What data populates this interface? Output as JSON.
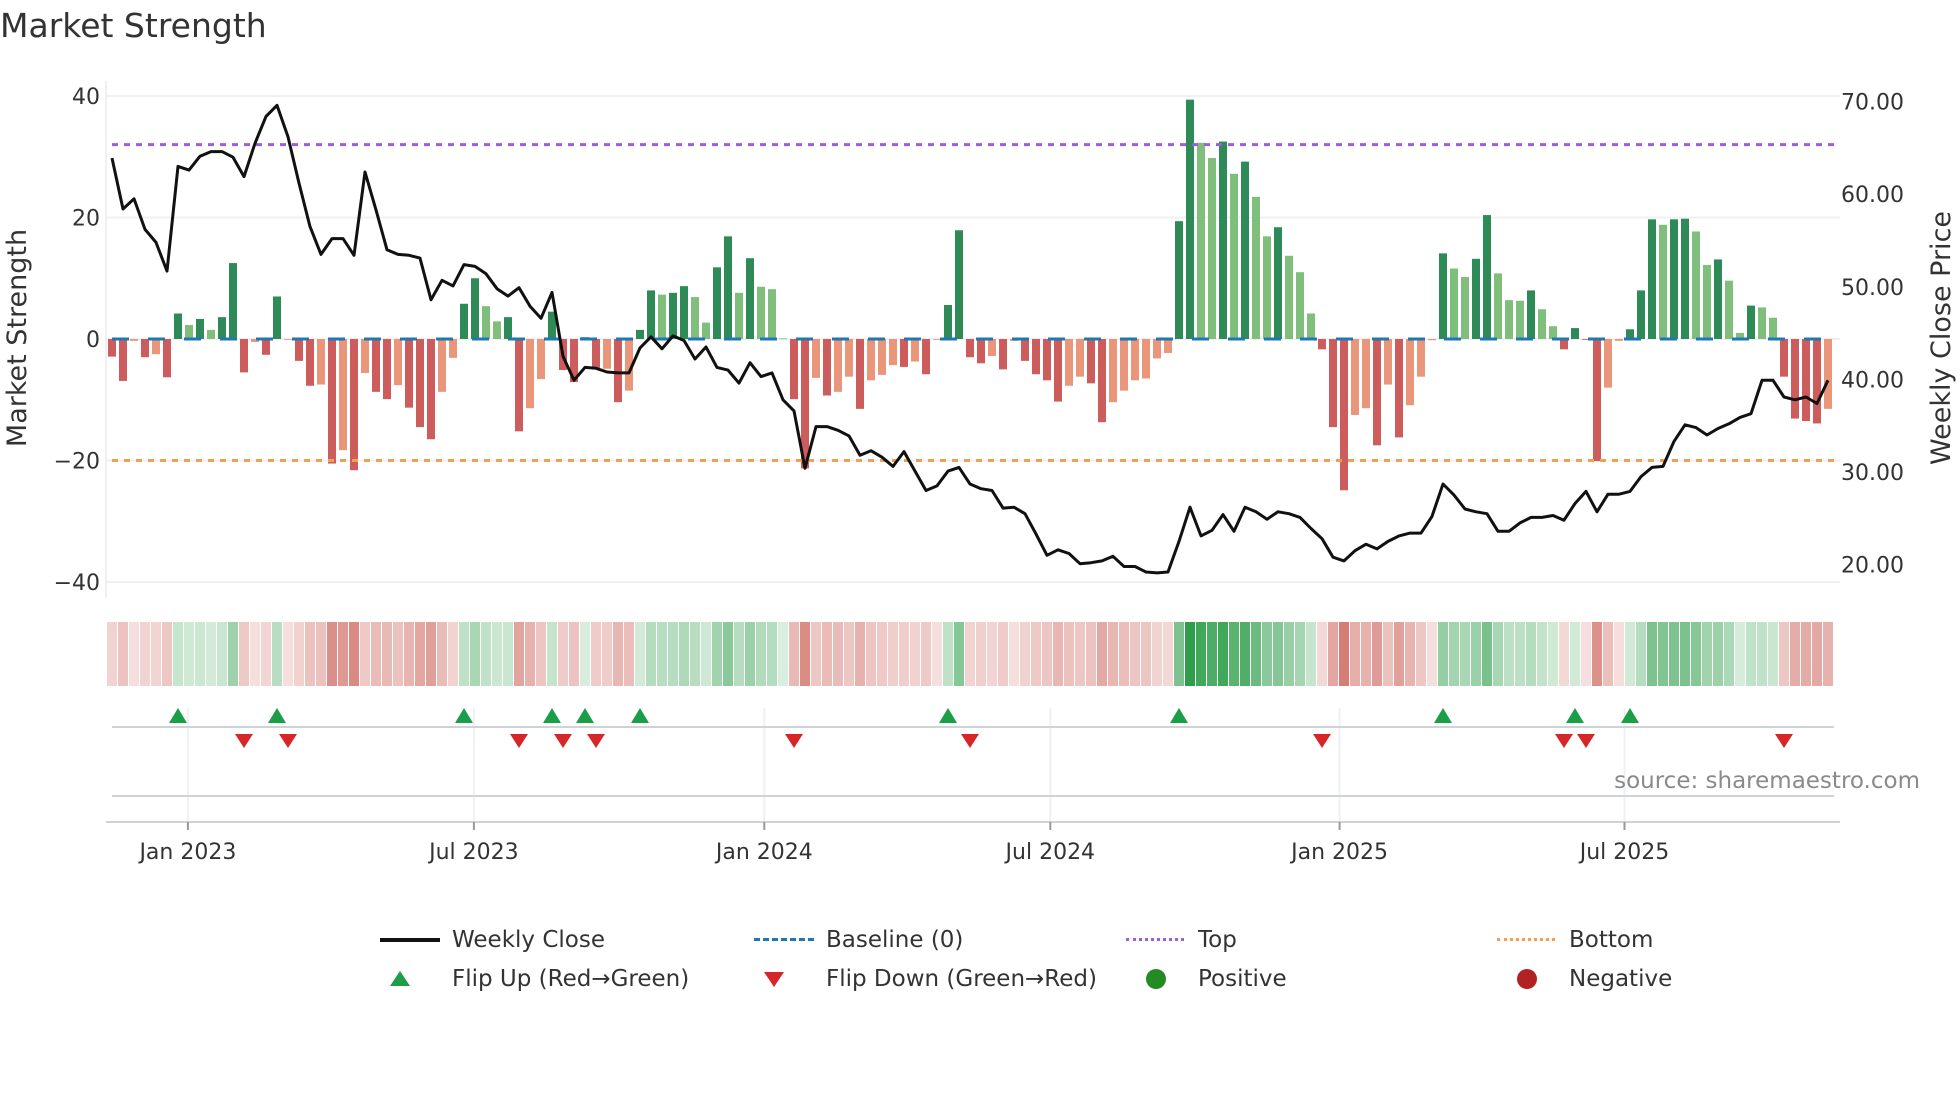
{
  "chart_data": {
    "type": "bar",
    "title": "Market Strength",
    "ylabel": "Market Strength",
    "y2label": "Weekly Close Price",
    "ylim": [
      -40,
      40
    ],
    "y2lim": [
      18.1,
      70.6
    ],
    "yticks": [
      "40",
      "20",
      "0",
      "−20",
      "−40"
    ],
    "ytick_values": [
      40,
      20,
      0,
      -20,
      -40
    ],
    "y2ticks": [
      "70.00",
      "60.00",
      "50.00",
      "40.00",
      "30.00",
      "20.00"
    ],
    "y2tick_values": [
      70,
      60,
      50,
      40,
      30,
      20
    ],
    "xticks": [
      {
        "label": "Jan 2023",
        "week": 7.9
      },
      {
        "label": "Jul 2023",
        "week": 33.9
      },
      {
        "label": "Jan 2024",
        "week": 60.3
      },
      {
        "label": "Jul 2024",
        "week": 86.3
      },
      {
        "label": "Jan 2025",
        "week": 112.6
      },
      {
        "label": "Jul 2025",
        "week": 138.5
      }
    ],
    "top_level": 32,
    "bottom_level": -20,
    "baseline": 0,
    "strength": [
      -2.9,
      -6.9,
      -0.3,
      -3,
      -2.5,
      -6.3,
      4.2,
      2.3,
      3.3,
      1.5,
      3.6,
      12.5,
      -5.5,
      -0.5,
      -2.6,
      7,
      -0.1,
      -3.6,
      -7.7,
      -7.5,
      -20.5,
      -18.3,
      -21.6,
      -5.6,
      -8.7,
      -9.9,
      -7.6,
      -11.3,
      -14.5,
      -16.5,
      -8.7,
      -3.1,
      5.8,
      10,
      5.4,
      2.9,
      3.6,
      -15.2,
      -11.4,
      -6.6,
      4.5,
      -5.1,
      -7.1,
      0.3,
      -4.9,
      -4.9,
      -10.4,
      -8.5,
      1.5,
      8,
      7.3,
      7.6,
      8.7,
      6.9,
      2.7,
      11.8,
      16.9,
      7.6,
      13.3,
      8.6,
      8.2,
      0.1,
      -9.9,
      -21.3,
      -6.4,
      -9.3,
      -8.7,
      -6.2,
      -11.5,
      -6.8,
      -5.9,
      -4.3,
      -4.6,
      -3.7,
      -5.8,
      -0.1,
      5.6,
      17.9,
      -3,
      -4,
      -2.8,
      -5,
      -0.3,
      -3.6,
      -5.8,
      -6.8,
      -10.3,
      -7.7,
      -6.2,
      -7.3,
      -13.7,
      -10.4,
      -8.5,
      -6.8,
      -6.5,
      -3.2,
      -2.3,
      19.4,
      39.4,
      32.3,
      29.8,
      32.5,
      27.2,
      29.2,
      23.4,
      16.9,
      18.4,
      13.7,
      11,
      4.2,
      -1.7,
      -14.5,
      -24.9,
      -12.5,
      -11.4,
      -17.5,
      -7.5,
      -16.2,
      -10.9,
      -6.2,
      -0.2,
      14.1,
      11.6,
      10.2,
      13.2,
      20.4,
      10.8,
      6.4,
      6.3,
      8,
      4.9,
      2.1,
      -1.7,
      1.8,
      -0.1,
      -20.1,
      -8,
      -0.3,
      1.6,
      8,
      19.7,
      18.8,
      19.7,
      19.8,
      17.7,
      12.2,
      13.1,
      9.6,
      1,
      5.5,
      5.2,
      3.5,
      -6.2,
      -13.1,
      -13.5,
      -13.9,
      -11.5
    ],
    "strong": [
      1,
      1,
      0,
      1,
      0,
      1,
      1,
      0,
      1,
      0,
      1,
      1,
      1,
      0,
      1,
      1,
      0,
      1,
      1,
      0,
      1,
      0,
      1,
      0,
      1,
      1,
      0,
      1,
      1,
      1,
      0,
      0,
      1,
      1,
      0,
      0,
      1,
      1,
      0,
      0,
      1,
      1,
      1,
      1,
      1,
      0,
      1,
      0,
      1,
      1,
      0,
      1,
      1,
      0,
      0,
      1,
      1,
      0,
      1,
      0,
      0,
      0,
      1,
      1,
      0,
      1,
      0,
      0,
      1,
      0,
      0,
      0,
      1,
      0,
      1,
      0,
      1,
      1,
      1,
      1,
      0,
      1,
      0,
      1,
      1,
      1,
      1,
      0,
      0,
      1,
      1,
      0,
      0,
      0,
      0,
      0,
      0,
      1,
      1,
      0,
      0,
      1,
      0,
      1,
      0,
      0,
      1,
      0,
      0,
      0,
      1,
      1,
      1,
      0,
      0,
      1,
      0,
      1,
      0,
      0,
      0,
      1,
      0,
      0,
      1,
      1,
      0,
      0,
      0,
      1,
      0,
      0,
      1,
      1,
      1,
      1,
      0,
      0,
      1,
      1,
      1,
      0,
      1,
      1,
      0,
      0,
      1,
      0,
      0,
      1,
      0,
      0,
      1,
      1,
      1,
      1,
      0
    ],
    "close": [
      63.9,
      58.4,
      59.5,
      56.2,
      54.8,
      51.7,
      63.0,
      62.6,
      64.1,
      64.6,
      64.6,
      64.0,
      61.9,
      65.5,
      68.4,
      69.6,
      66.2,
      61.2,
      56.5,
      53.5,
      55.2,
      55.2,
      53.4,
      62.4,
      58.3,
      54.0,
      53.5,
      53.4,
      53.1,
      48.6,
      50.7,
      50.1,
      52.4,
      52.2,
      51.4,
      49.8,
      49.0,
      49.9,
      47.9,
      46.6,
      49.4,
      42.5,
      39.9,
      41.3,
      41.2,
      40.8,
      40.7,
      40.7,
      43.4,
      44.6,
      43.3,
      44.7,
      44.2,
      42.2,
      43.5,
      41.3,
      41.0,
      39.6,
      41.8,
      40.3,
      40.7,
      37.8,
      36.6,
      30.4,
      34.9,
      34.9,
      34.5,
      33.9,
      31.8,
      32.3,
      31.6,
      30.6,
      32.2,
      30.1,
      28.0,
      28.5,
      30.1,
      30.5,
      28.7,
      28.2,
      28.0,
      26.1,
      26.2,
      25.5,
      23.3,
      21.0,
      21.6,
      21.2,
      20.1,
      20.2,
      20.4,
      20.9,
      19.8,
      19.8,
      19.2,
      19.1,
      19.2,
      22.5,
      26.2,
      23.1,
      23.7,
      25.4,
      23.6,
      26.2,
      25.7,
      24.9,
      25.7,
      25.5,
      25.1,
      23.9,
      22.8,
      20.8,
      20.4,
      21.5,
      22.2,
      21.7,
      22.5,
      23.1,
      23.4,
      23.4,
      25.2,
      28.7,
      27.5,
      26.0,
      25.7,
      25.5,
      23.6,
      23.6,
      24.5,
      25.1,
      25.1,
      25.3,
      24.8,
      26.6,
      27.9,
      25.7,
      27.6,
      27.6,
      27.9,
      29.5,
      30.5,
      30.6,
      33.3,
      35.1,
      34.8,
      34.0,
      34.7,
      35.2,
      35.9,
      36.3,
      39.9,
      39.9,
      38.1,
      37.8,
      38.1,
      37.4,
      39.9
    ],
    "flip_up_weeks": [
      7,
      16,
      33,
      41,
      44,
      49,
      77,
      98,
      122,
      134,
      139
    ],
    "flip_down_weeks": [
      13,
      17,
      38,
      42,
      45,
      63,
      79,
      111,
      133,
      135,
      153
    ],
    "legend": [
      {
        "key": "close",
        "label": "Weekly Close"
      },
      {
        "key": "baseline",
        "label": "Baseline (0)"
      },
      {
        "key": "top",
        "label": "Top"
      },
      {
        "key": "bottom",
        "label": "Bottom"
      },
      {
        "key": "flip_up",
        "label": "Flip Up (Red→Green)"
      },
      {
        "key": "flip_down",
        "label": "Flip Down (Green→Red)"
      },
      {
        "key": "positive",
        "label": "Positive"
      },
      {
        "key": "negative",
        "label": "Negative"
      }
    ],
    "legend_placement": "bottom",
    "source": "source: sharemaestro.com",
    "colors": {
      "pos_strong": "#2e8b57",
      "pos_weak": "#7fbf7b",
      "neg_strong": "#cd5c5c",
      "neg_weak": "#e9967a",
      "close": "#111111",
      "baseline": "#1f77b4",
      "top": "#9b5fd6",
      "bottom": "#f0a050",
      "flip_up": "#1a9e48",
      "flip_down": "#d62728",
      "positive": "#228b22",
      "negative": "#b22222"
    }
  }
}
